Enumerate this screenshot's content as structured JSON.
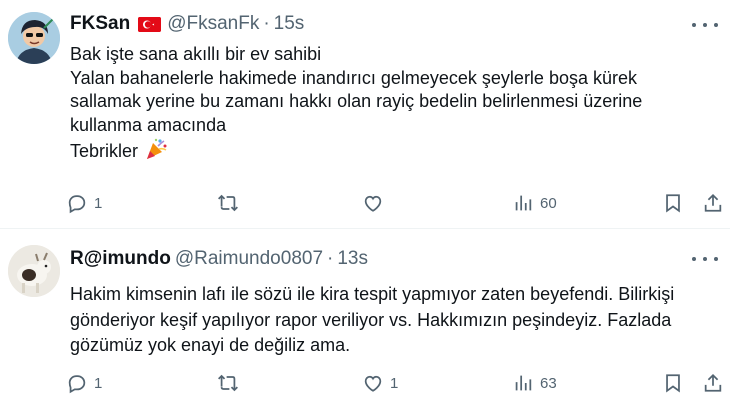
{
  "tweets": [
    {
      "name": "FKSan",
      "handle": "@FksanFk",
      "separator": "·",
      "time": "15s",
      "lines": [
        "Bak işte sana akıllı bir ev sahibi",
        "Yalan bahanelerle hakimede inandırıcı gelmeyecek şeylerle boşa kürek",
        "sallamak yerine bu zamanı hakkı olan rayiç bedelin belirlenmesi üzerine",
        "kullanma amacında",
        "Tebrikler"
      ],
      "emoji": "party-popper",
      "flag": "turkey",
      "reply_count": "1",
      "retweet_count": "",
      "like_count": "",
      "view_count": "60"
    },
    {
      "name": "R@imundo",
      "handle": "@Raimundo0807",
      "separator": "·",
      "time": "13s",
      "lines": [
        "Hakim kimsenin lafı ile sözü ile kira tespit yapmıyor zaten beyefendi. Bilirkişi",
        "gönderiyor keşif yapılıyor rapor veriliyor vs. Hakkımızın peşindeyiz. Fazlada",
        "gözümüz yok enayi de değiliz ama."
      ],
      "reply_count": "1",
      "retweet_count": "",
      "like_count": "1",
      "view_count": "63"
    }
  ],
  "icons": [
    "reply-icon",
    "retweet-icon",
    "like-icon",
    "views-icon",
    "bookmark-icon",
    "share-icon",
    "more-icon"
  ],
  "colors": {
    "text": "#0f1419",
    "secondary": "#536471",
    "divider": "#eff3f4",
    "flag": "#e30a17"
  }
}
